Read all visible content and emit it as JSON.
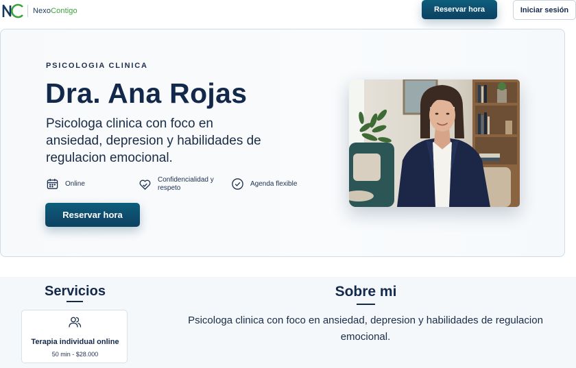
{
  "brand": {
    "mark": "NC",
    "name_part1": "Nexo",
    "name_part2": "Contigo"
  },
  "header": {
    "reserve_label": "Reservar hora",
    "login_label": "Iniciar sesión"
  },
  "hero": {
    "eyebrow": "PSICOLOGIA CLINICA",
    "name": "Dra. Ana Rojas",
    "description": "Psicologa clinica con foco en ansiedad, depresion y habilidades de regulacion emocional.",
    "features": [
      {
        "icon": "calendar-icon",
        "label": "Online"
      },
      {
        "icon": "heart-handshake-icon",
        "label": "Confidencialidad y respeto"
      },
      {
        "icon": "check-circle-icon",
        "label": "Agenda flexible"
      }
    ],
    "reserve_label": "Reservar hora"
  },
  "services": {
    "title": "Servicios",
    "items": [
      {
        "icon": "users-icon",
        "name": "Terapia individual online",
        "price": "50 min - $28.000"
      }
    ]
  },
  "about": {
    "title": "Sobre mi",
    "text": "Psicologa clinica con foco en ansiedad, depresion y habilidades de regulacion emocional."
  },
  "colors": {
    "primary": "#0e4c6d",
    "navy": "#13294b",
    "accent_green": "#3aa23b",
    "border": "#cfdbe4"
  }
}
